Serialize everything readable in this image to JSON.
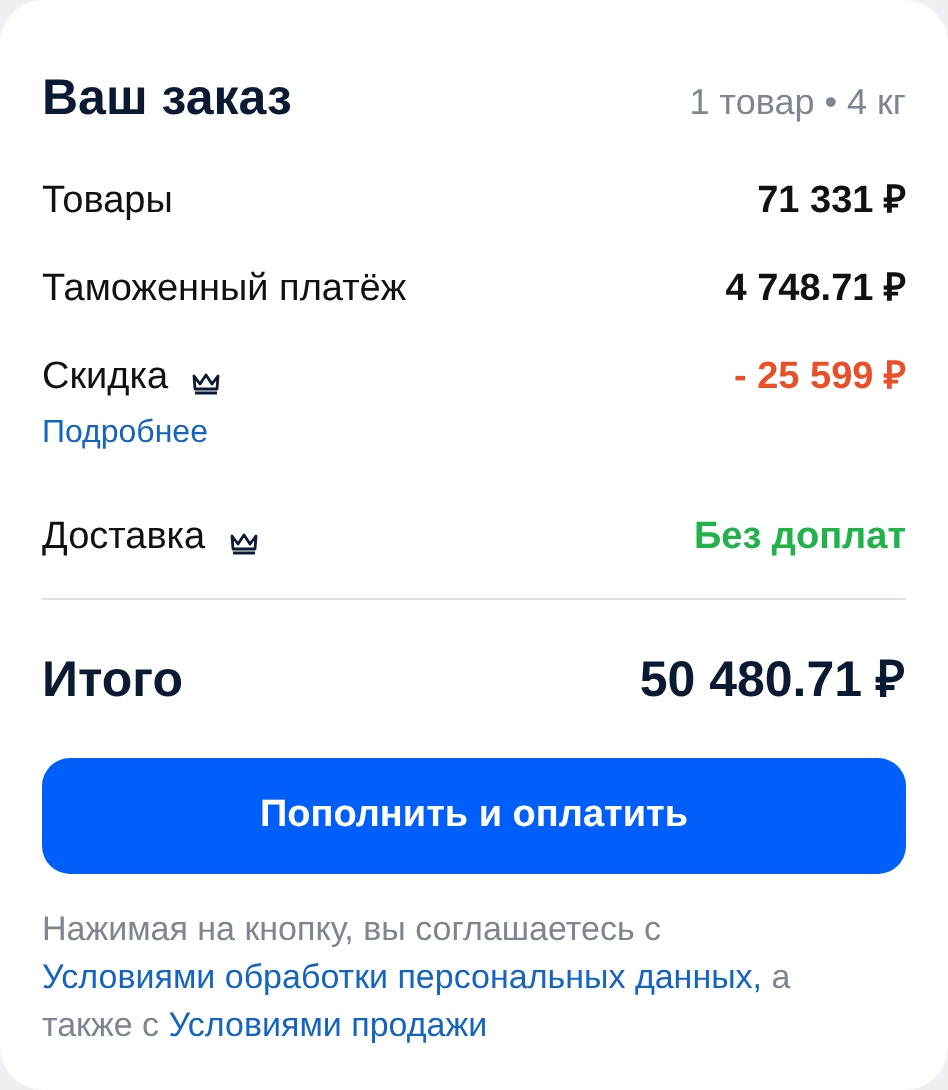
{
  "title": "Ваш заказ",
  "summary": "1 товар • 4 кг",
  "rows": [
    {
      "label": "Товары",
      "value": "71 331 ₽",
      "kind": "normal",
      "premium": false
    },
    {
      "label": "Таможенный платёж",
      "value": "4 748.71 ₽",
      "kind": "normal",
      "premium": false
    },
    {
      "label": "Скидка",
      "value": "- 25 599 ₽",
      "kind": "discount",
      "premium": true,
      "link": "Подробнее"
    },
    {
      "label": "Доставка",
      "value": "Без доплат",
      "kind": "free",
      "premium": true
    }
  ],
  "total": {
    "label": "Итого",
    "value": "50 480.71 ₽"
  },
  "button": "Пополнить и оплатить",
  "consent": [
    {
      "kind": "text",
      "text": "Нажимая на кнопку, вы соглашаетесь с "
    },
    {
      "kind": "link",
      "text": "Условиями обработки персональных данных,"
    },
    {
      "kind": "text",
      "text": " а также с "
    },
    {
      "kind": "link",
      "text": "Условиями продажи"
    }
  ]
}
